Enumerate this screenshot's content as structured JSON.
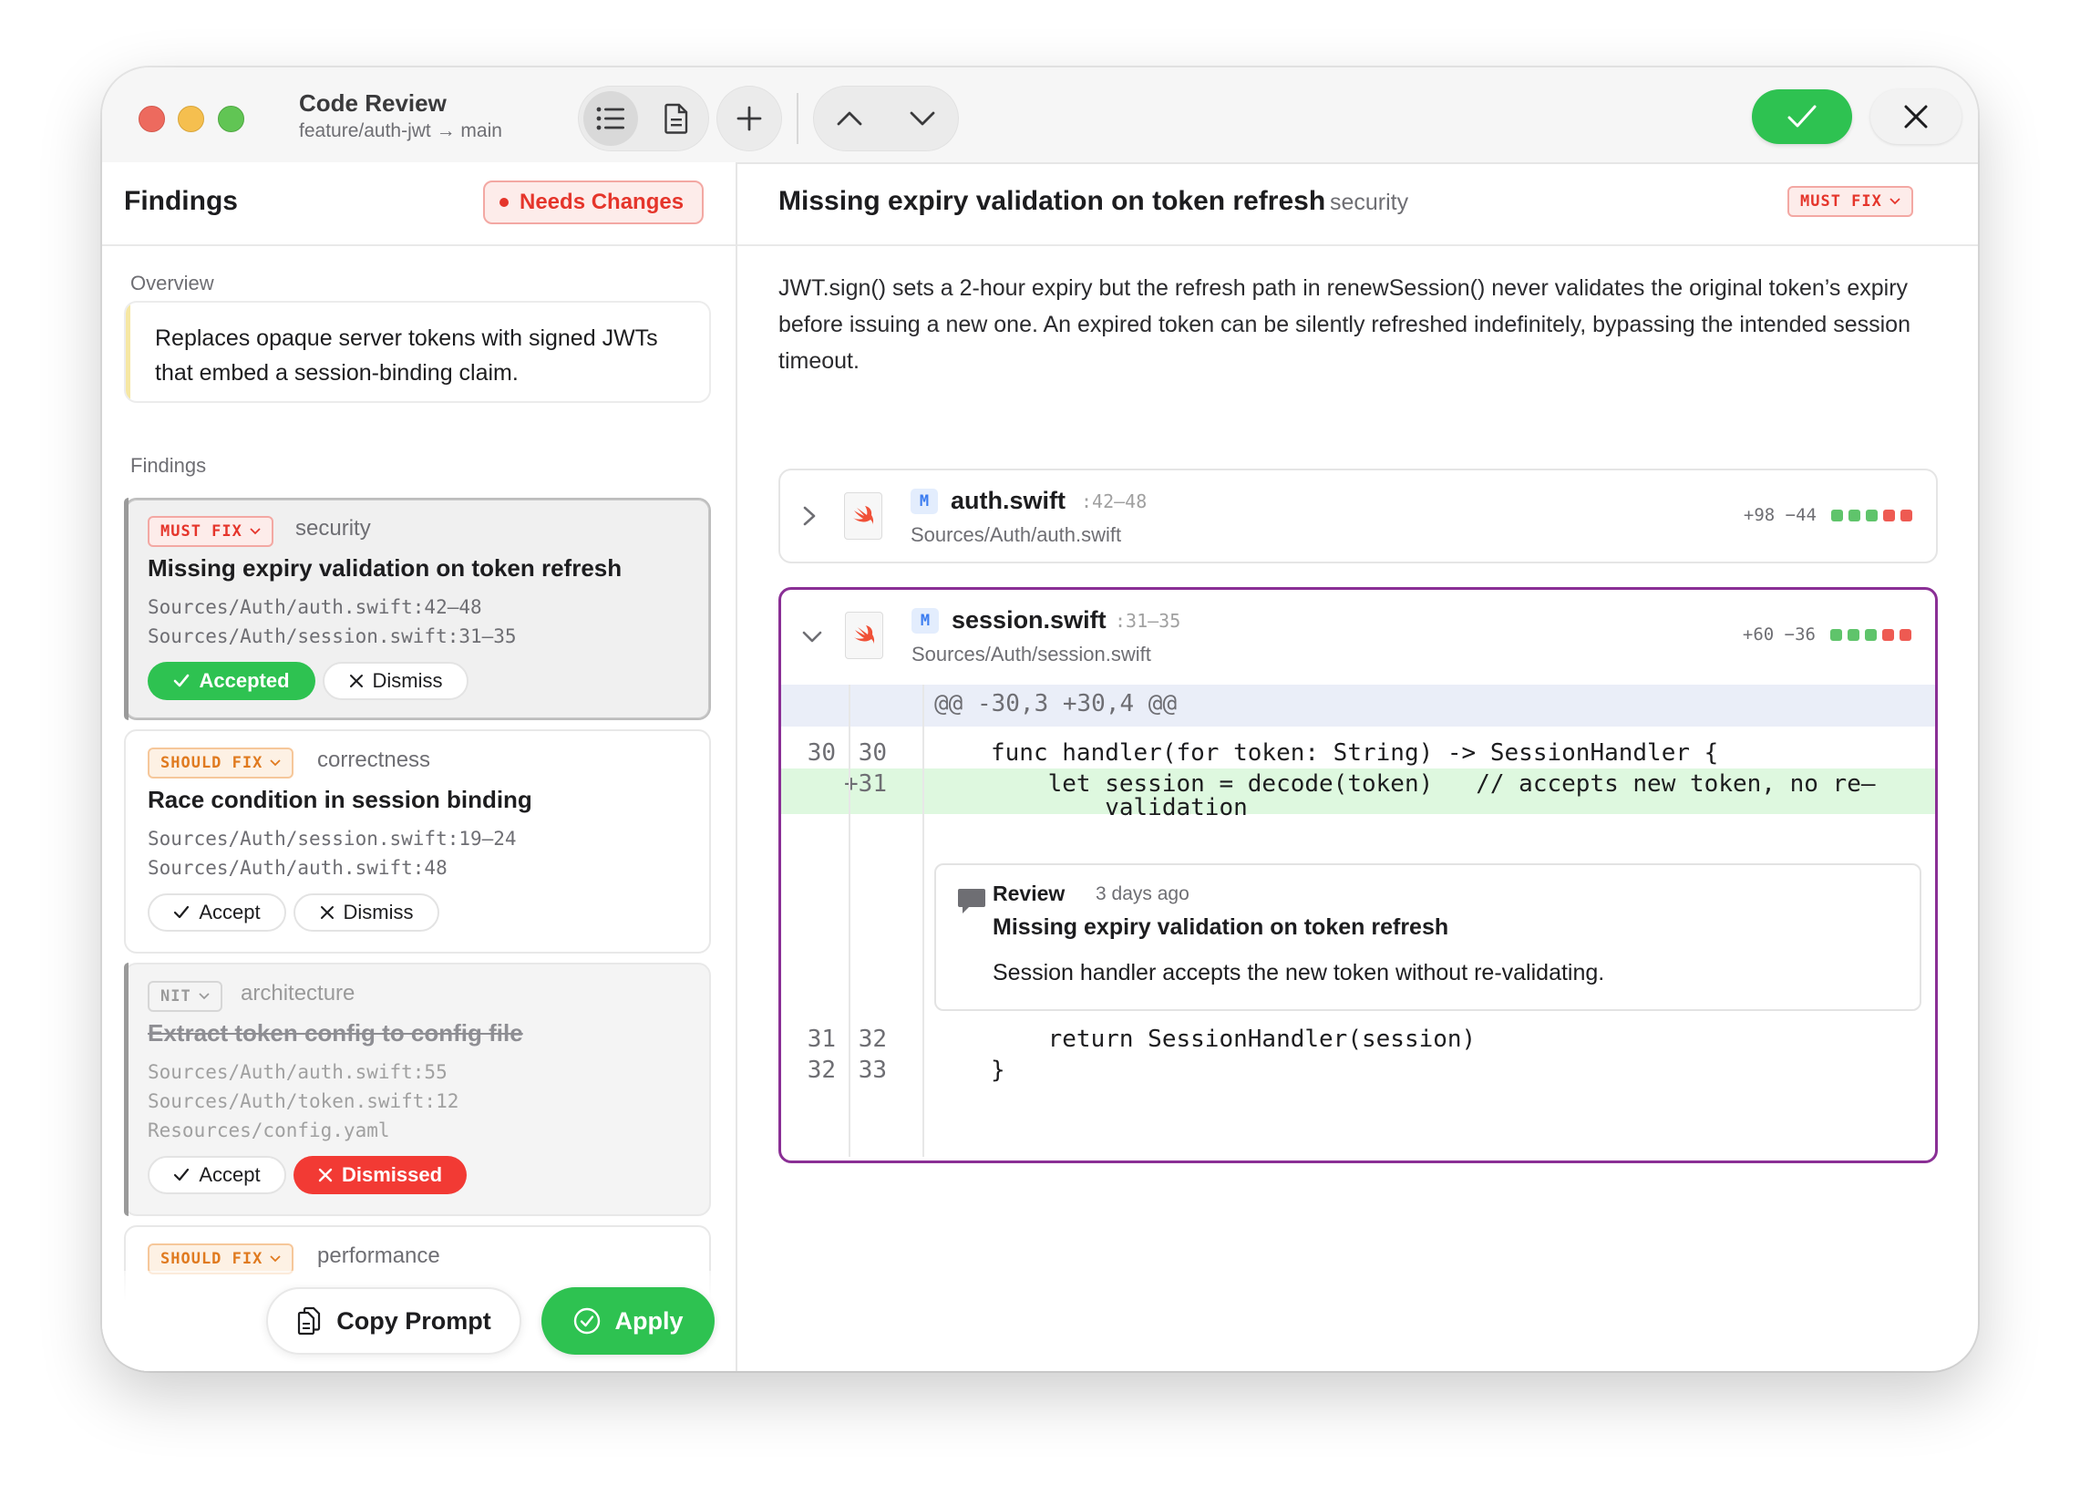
{
  "titlebar": {
    "title": "Code Review",
    "branch": "feature/auth-jwt → main"
  },
  "left": {
    "title": "Findings",
    "status_badge": "Needs Changes",
    "overview_label": "Overview",
    "overview_text": "Replaces opaque server tokens with signed JWTs that embed a session-binding claim.",
    "findings_label": "Findings",
    "findings": [
      {
        "severity": "MUST FIX",
        "category": "security",
        "title": "Missing expiry validation on token refresh",
        "locations": [
          "Sources/Auth/auth.swift:42–48",
          "Sources/Auth/session.swift:31–35"
        ],
        "accept_label": "Accepted",
        "dismiss_label": "Dismiss"
      },
      {
        "severity": "SHOULD FIX",
        "category": "correctness",
        "title": "Race condition in session binding",
        "locations": [
          "Sources/Auth/session.swift:19–24",
          "Sources/Auth/auth.swift:48"
        ],
        "accept_label": "Accept",
        "dismiss_label": "Dismiss"
      },
      {
        "severity": "NIT",
        "category": "architecture",
        "title": "Extract token config to config file",
        "locations": [
          "Sources/Auth/auth.swift:55",
          "Sources/Auth/token.swift:12",
          "Resources/config.yaml"
        ],
        "accept_label": "Accept",
        "dismiss_label": "Dismissed"
      },
      {
        "severity": "SHOULD FIX",
        "category": "performance"
      }
    ],
    "copy_prompt_label": "Copy Prompt",
    "apply_label": "Apply"
  },
  "right": {
    "title": "Missing expiry validation on token refresh",
    "category": "security",
    "severity": "MUST FIX",
    "description": "JWT.sign() sets a 2-hour expiry but the refresh path in renewSession() never validates the original token’s expiry before issuing a new one. An expired token can be silently refreshed indefinitely, bypassing the intended session timeout.",
    "files": [
      {
        "badge": "M",
        "name": "auth.swift",
        "range": ":42–48",
        "path": "Sources/Auth/auth.swift",
        "stats": "+98 −44"
      },
      {
        "badge": "M",
        "name": "session.swift",
        "range": ":31–35",
        "path": "Sources/Auth/session.swift",
        "stats": "+60 −36"
      }
    ],
    "diff": {
      "hunk": "@@ -30,3 +30,4 @@",
      "lines": [
        {
          "old": "30",
          "new": "30",
          "code": "func handler(for token: String) -> SessionHandler {"
        },
        {
          "old": "",
          "new": "+31",
          "code": "    let session = decode(token)   // accepts new token, no re–",
          "cont": "        validation"
        },
        {
          "old": "31",
          "new": "32",
          "code": "    return SessionHandler(session)"
        },
        {
          "old": "32",
          "new": "33",
          "code": "}"
        }
      ]
    },
    "comment": {
      "author": "Review",
      "time": "3 days ago",
      "title": "Missing expiry validation on token refresh",
      "body": "Session handler accepts the new token without re-validating."
    }
  },
  "colors": {
    "accent_green": "#2ec251",
    "danger_red": "#e5352b",
    "active_border": "#8a2f95",
    "added_line_bg": "#def8df"
  }
}
